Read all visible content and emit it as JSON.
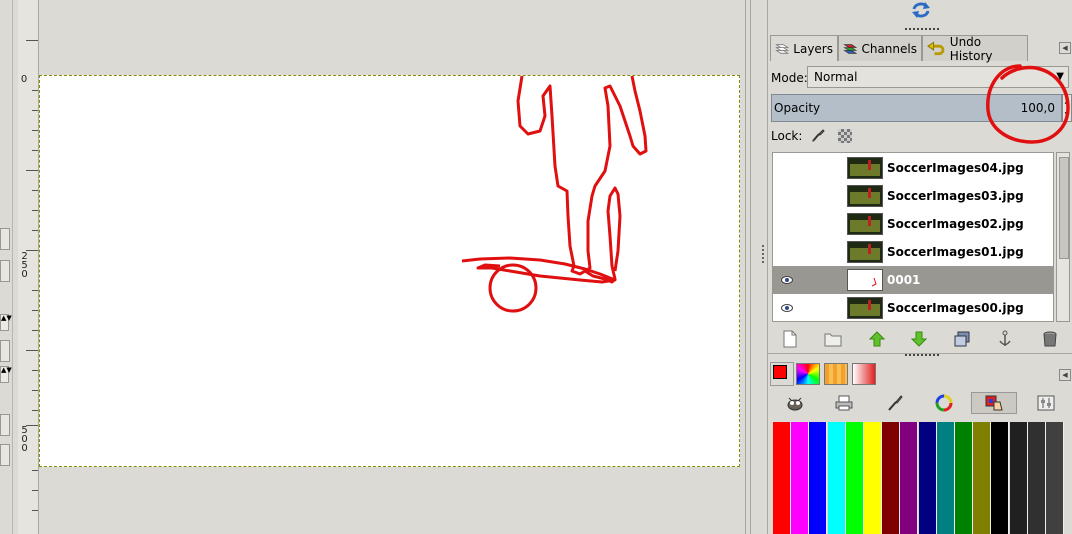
{
  "canvas": {
    "ruler_labels": [
      "0",
      "250",
      "500"
    ]
  },
  "dock": {
    "tabs": [
      {
        "label": "Layers",
        "icon": "layers-icon",
        "active": true
      },
      {
        "label": "Channels",
        "icon": "channels-icon",
        "active": false
      },
      {
        "label": "Undo History",
        "icon": "undo-history-icon",
        "active": false
      }
    ],
    "mode_label": "Mode:",
    "mode_value": "Normal",
    "opacity_label": "Opacity",
    "opacity_value": "100,0",
    "lock_label": "Lock:",
    "layers": [
      {
        "name": "SoccerImages04.jpg",
        "visible": false,
        "selected": false
      },
      {
        "name": "SoccerImages03.jpg",
        "visible": false,
        "selected": false
      },
      {
        "name": "SoccerImages02.jpg",
        "visible": false,
        "selected": false
      },
      {
        "name": "SoccerImages01.jpg",
        "visible": false,
        "selected": false
      },
      {
        "name": "0001",
        "visible": true,
        "selected": true
      },
      {
        "name": "SoccerImages00.jpg",
        "visible": true,
        "selected": false
      }
    ],
    "layer_actions": [
      "new-layer-icon",
      "open-folder-icon",
      "raise-layer-icon",
      "lower-layer-icon",
      "duplicate-layer-icon",
      "anchor-layer-icon",
      "delete-layer-icon"
    ],
    "colors": {
      "foreground": "#ff0000",
      "accent": "#b3bec9",
      "annotation": "#e01010"
    },
    "palette": [
      "#ff0000",
      "#ff00ff",
      "#0000ff",
      "#00ffff",
      "#00ff00",
      "#ffff00",
      "#800000",
      "#800080",
      "#000080",
      "#008080",
      "#008000",
      "#808000",
      "#000000",
      "#202020",
      "#303030",
      "#404040"
    ]
  }
}
